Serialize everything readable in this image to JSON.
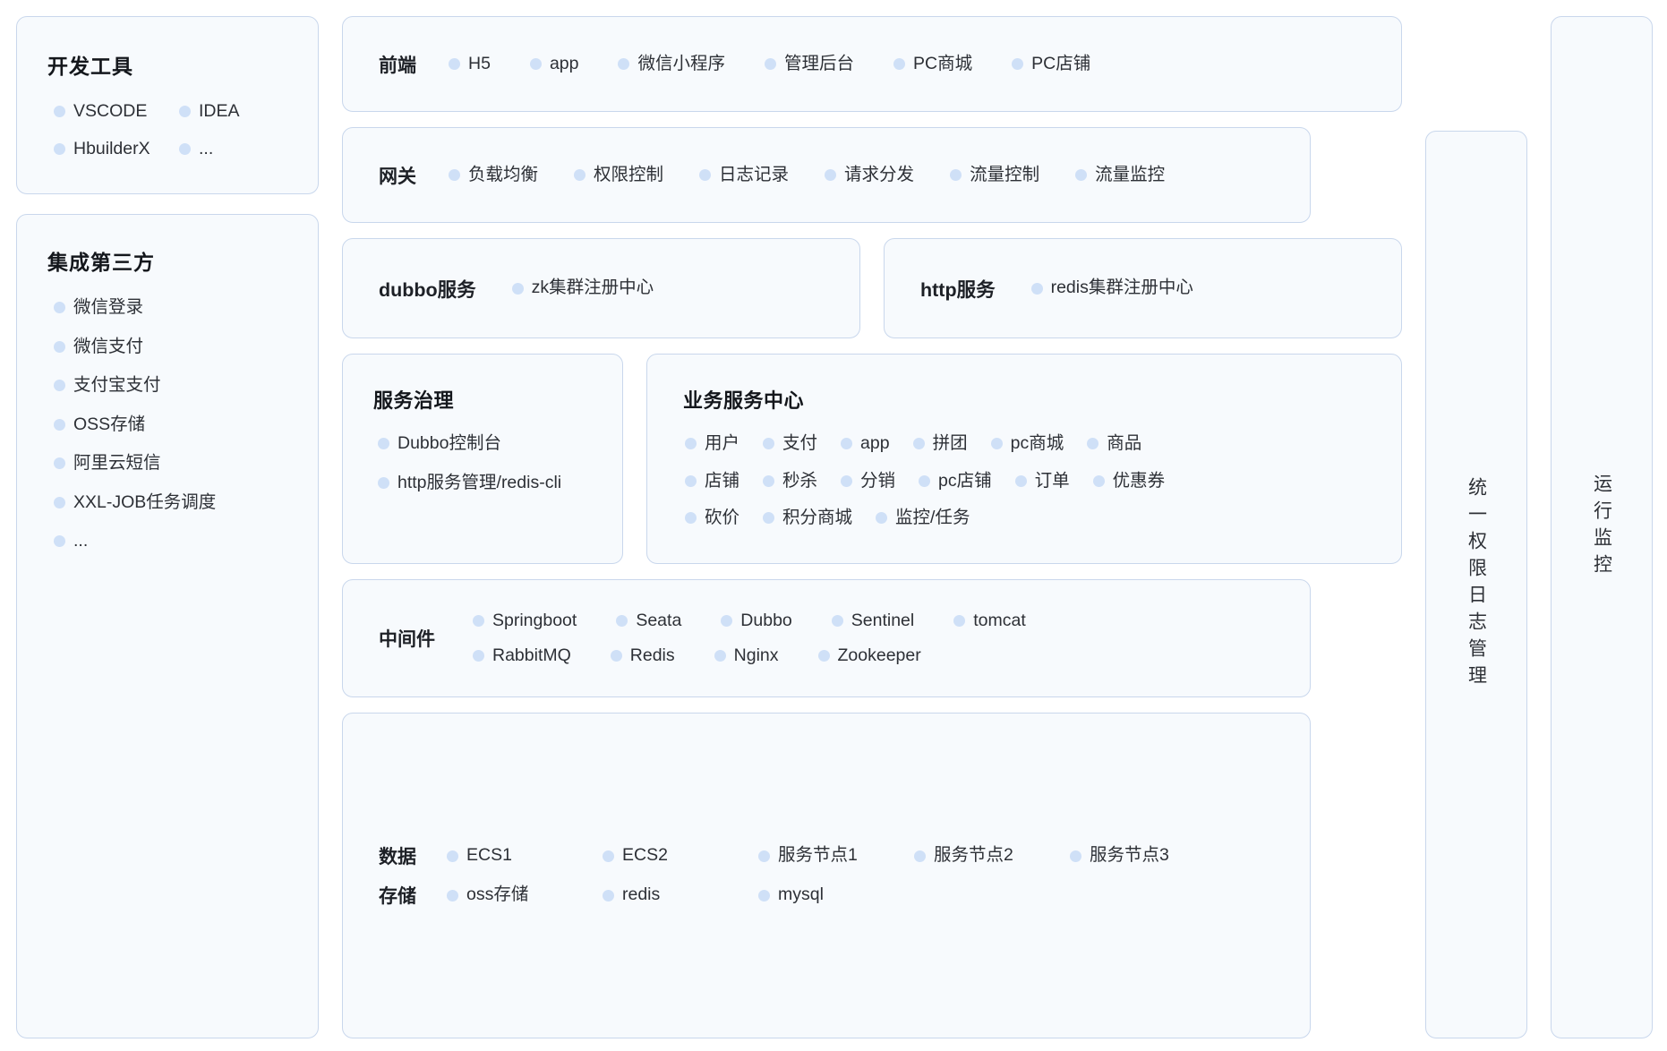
{
  "left": {
    "dev_tools": {
      "title": "开发工具",
      "items": [
        "VSCODE",
        "IDEA",
        "HbuilderX",
        "..."
      ]
    },
    "third_party": {
      "title": "集成第三方",
      "items": [
        "微信登录",
        "微信支付",
        "支付宝支付",
        "OSS存储",
        "阿里云短信",
        "XXL-JOB任务调度",
        "..."
      ]
    }
  },
  "middle": {
    "frontend": {
      "title": "前端",
      "items": [
        "H5",
        "app",
        "微信小程序",
        "管理后台",
        "PC商城",
        "PC店铺"
      ]
    },
    "gateway": {
      "title": "网关",
      "items": [
        "负载均衡",
        "权限控制",
        "日志记录",
        "请求分发",
        "流量控制",
        "流量监控"
      ]
    },
    "dubbo_service": {
      "title": "dubbo服务",
      "items": [
        "zk集群注册中心"
      ]
    },
    "http_service": {
      "title": "http服务",
      "items": [
        "redis集群注册中心"
      ]
    },
    "governance": {
      "title": "服务治理",
      "items": [
        "Dubbo控制台",
        "http服务管理/redis-cli"
      ]
    },
    "business_center": {
      "title": "业务服务中心",
      "rows": [
        [
          "用户",
          "支付",
          "app",
          "拼团",
          "pc商城",
          "商品"
        ],
        [
          "店铺",
          "秒杀",
          "分销",
          "pc店铺",
          "订单",
          "优惠券"
        ],
        [
          "砍价",
          "积分商城",
          "监控/任务"
        ]
      ]
    },
    "middleware": {
      "title": "中间件",
      "rows": [
        [
          "Springboot",
          "Seata",
          "Dubbo",
          "Sentinel",
          "tomcat"
        ],
        [
          "RabbitMQ",
          "Redis",
          "Nginx",
          "Zookeeper"
        ]
      ]
    },
    "data_storage": {
      "data_label": "数据",
      "storage_label": "存储",
      "data_items": [
        "ECS1",
        "ECS2",
        "服务节点1",
        "服务节点2",
        "服务节点3"
      ],
      "storage_items": [
        "oss存储",
        "redis",
        "mysql"
      ]
    }
  },
  "right": {
    "permission_log": "统一权限日志管理",
    "runtime_monitor": "运行监控"
  },
  "colors": {
    "card_bg": "#f7fafd",
    "card_border": "#c9d7ec",
    "bullet": "#cfe0f7",
    "text": "#2d3036",
    "title": "#14171c",
    "page_bg": "#ffffff"
  }
}
